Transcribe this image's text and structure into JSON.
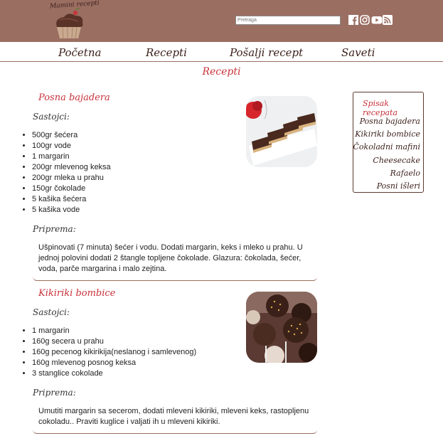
{
  "header": {
    "logo_text": "Mamini recepti",
    "search": {
      "placeholder": "Pretraga",
      "value": ""
    },
    "social": [
      "facebook-icon",
      "instagram-icon",
      "youtube-icon",
      "rss-icon"
    ],
    "colors": {
      "bar": "#9b6e62",
      "accent": "#c8323b"
    }
  },
  "nav": [
    "Početna",
    "Recepti",
    "Pošalji recept",
    "Saveti"
  ],
  "page_heading": "Recepti",
  "recipes": [
    {
      "title": "Posna bajadera",
      "ingredients_label": "Sastojci:",
      "ingredients": [
        "500gr šećera",
        "100gr vode",
        "1 margarin",
        "200gr mlevenog keksa",
        "200gr mleka u prahu",
        "150gr čokolade",
        "5 kašika šećera",
        "5 kašika vode"
      ],
      "prep_label": "Priprema:",
      "prep": "Ušpinovati (7 minuta) šećer i vodu. Dodati margarin, keks i mleko u prahu. U jednoj polovini dodati 2 štangle topljene čokolade. Glazura: čokolada, šećer, voda, parče margarina i malo zejtina."
    },
    {
      "title": "Kikiriki bombice",
      "ingredients_label": "Sastojci:",
      "ingredients": [
        "1 margarin",
        "160g secera u prahu",
        "160g pecenog kikirikija(neslanog i samlevenog)",
        "160g mlevenog posnog keksa",
        "3 stanglice cokolade"
      ],
      "prep_label": "Priprema:",
      "prep": "Umutiti margarin sa secerom, dodati mleveni kikiriki, mleveni keks, rastopljenu cokoladu.. Praviti kuglice i valjati ih u mleveni kikiriki."
    }
  ],
  "sidebar": {
    "title": "Spisak recepata",
    "items": [
      "Posna bajadera",
      "Kikiriki bombice",
      "Čokoladni mafini",
      "Cheesecake",
      "Rafaelo",
      "Posni išleri"
    ]
  }
}
